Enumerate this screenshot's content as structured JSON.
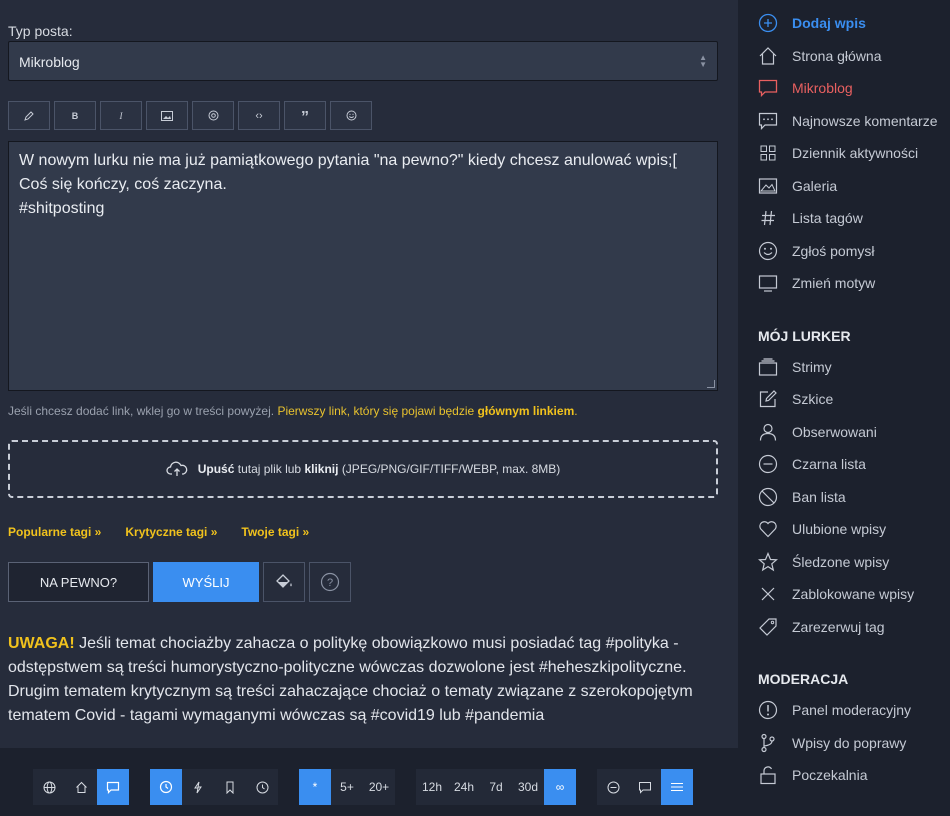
{
  "form": {
    "type_label": "Typ posta:",
    "type_value": "Mikroblog",
    "toolbar": [
      "pencil-icon",
      "bold",
      "italic",
      "image-icon",
      "spoiler-icon",
      "code-icon",
      "quote-icon",
      "emoji-icon"
    ],
    "toolbar_labels": {
      "bold": "B",
      "italic": "I"
    },
    "text_line1": "W nowym lurku nie ma już pamiątkowego pytania \"na pewno?\" kiedy chcesz anulować wpis;[",
    "text_line2": "Coś się kończy, coś zaczyna.",
    "text_line3": "#shitposting",
    "hint_part1": "Jeśli chcesz dodać link, wklej go w treści powyżej.",
    "hint_part2": "Pierwszy link, który się pojawi będzie",
    "hint_part3": "głównym linkiem",
    "hint_part4": ".",
    "upload_drop": "Upuść",
    "upload_mid": "tutaj plik lub",
    "upload_click": "kliknij",
    "upload_formats": "(JPEG/PNG/GIF/TIFF/WEBP, max. 8MB)",
    "tags": [
      "Popularne tagi »",
      "Krytyczne tagi »",
      "Twoje tagi »"
    ],
    "btn_cancel": "NA PEWNO?",
    "btn_send": "WYŚLIJ"
  },
  "warning": {
    "label": "UWAGA!",
    "text": "Jeśli temat chociażby zahacza o politykę obowiązkowo musi posiadać tag #polityka - odstępstwem są treści humorystyczno-polityczne wówczas dozwolone jest #heheszkipolityczne. Drugim tematem krytycznym są treści zahaczające chociaż o tematy związane z szerokopojętym tematem Covid - tagami wymaganymi wówczas są #covid19 lub #pandemia"
  },
  "sidebar": {
    "items": [
      {
        "label": "Dodaj wpis",
        "icon": "plus-circle-icon"
      },
      {
        "label": "Strona główna",
        "icon": "home-icon"
      },
      {
        "label": "Mikroblog",
        "icon": "chat-icon"
      },
      {
        "label": "Najnowsze komentarze",
        "icon": "comments-icon"
      },
      {
        "label": "Dziennik aktywności",
        "icon": "grid-icon"
      },
      {
        "label": "Galeria",
        "icon": "image-icon"
      },
      {
        "label": "Lista tagów",
        "icon": "hash-icon"
      },
      {
        "label": "Zgłoś pomysł",
        "icon": "smile-icon"
      },
      {
        "label": "Zmień motyw",
        "icon": "monitor-icon"
      }
    ],
    "section_my": "MÓJ LURKER",
    "my_items": [
      {
        "label": "Strimy",
        "icon": "stack-icon"
      },
      {
        "label": "Szkice",
        "icon": "edit-icon"
      },
      {
        "label": "Obserwowani",
        "icon": "user-icon"
      },
      {
        "label": "Czarna lista",
        "icon": "minus-circle-icon"
      },
      {
        "label": "Ban lista",
        "icon": "ban-icon"
      },
      {
        "label": "Ulubione wpisy",
        "icon": "heart-icon"
      },
      {
        "label": "Śledzone wpisy",
        "icon": "star-icon"
      },
      {
        "label": "Zablokowane wpisy",
        "icon": "x-icon"
      },
      {
        "label": "Zarezerwuj tag",
        "icon": "tag-icon"
      }
    ],
    "section_mod": "MODERACJA",
    "mod_items": [
      {
        "label": "Panel moderacyjny",
        "icon": "alert-circle-icon"
      },
      {
        "label": "Wpisy do poprawy",
        "icon": "branch-icon"
      },
      {
        "label": "Poczekalnia",
        "icon": "lock-icon"
      }
    ]
  },
  "bottombar": {
    "time_filters": [
      "5+",
      "20+",
      "12h",
      "24h",
      "7d",
      "30d"
    ],
    "star": "*",
    "infinity": "∞"
  },
  "colors": {
    "accent": "#3a8ef0",
    "warning": "#f0c21d",
    "danger": "#e86060"
  }
}
